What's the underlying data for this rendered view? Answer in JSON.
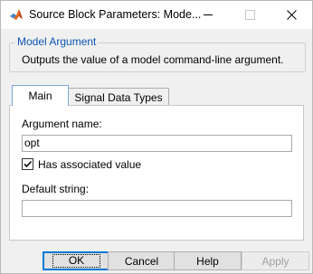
{
  "window": {
    "title": "Source Block Parameters: Mode...",
    "app_icon": "matlab-icon"
  },
  "group": {
    "legend": "Model Argument",
    "description": "Outputs the value of a model command-line argument."
  },
  "tabs": [
    {
      "label": "Main",
      "active": true
    },
    {
      "label": "Signal Data Types",
      "active": false
    }
  ],
  "main": {
    "argument_name_label": "Argument name:",
    "argument_name_value": "opt",
    "has_associated_value_label": "Has associated value",
    "has_associated_value_checked": true,
    "default_string_label": "Default string:",
    "default_string_value": ""
  },
  "buttons": {
    "ok": "OK",
    "cancel": "Cancel",
    "help": "Help",
    "apply": "Apply"
  }
}
